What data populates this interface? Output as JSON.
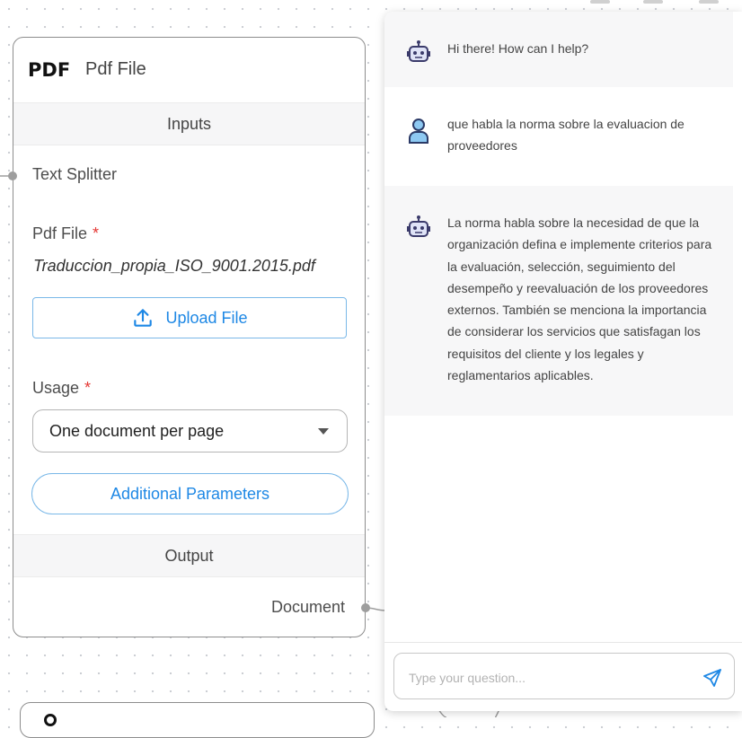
{
  "node": {
    "icon_label": "PDF",
    "title": "Pdf File",
    "inputs_label": "Inputs",
    "text_splitter_label": "Text Splitter",
    "pdf_file_label": "Pdf File",
    "required_mark": "*",
    "pdf_file_value": "Traduccion_propia_ISO_9001.2015.pdf",
    "upload_label": "Upload File",
    "usage_label": "Usage",
    "usage_value": "One document per page",
    "additional_params_label": "Additional Parameters",
    "output_label": "Output",
    "document_label": "Document"
  },
  "chat": {
    "messages": [
      {
        "role": "bot",
        "icon": "robot-icon",
        "text": "Hi there! How can I help?"
      },
      {
        "role": "user",
        "icon": "user-icon",
        "text": "que habla la norma sobre la evaluacion de proveedores"
      },
      {
        "role": "bot",
        "icon": "robot-icon",
        "text": "La norma habla sobre la necesidad de que la organización defina e implemente criterios para la evaluación, selección, seguimiento del desempeño y reevaluación de los proveedores externos. También se menciona la importancia de considerar los servicios que satisfagan los requisitos del cliente y los legales y reglamentarios aplicables."
      }
    ],
    "input_placeholder": "Type your question...",
    "send_icon": "send-icon"
  },
  "colors": {
    "accent": "#1e88e5",
    "required": "#e53935",
    "robot_body": "#3b3b6b",
    "user_icon": "#8ec9f2"
  }
}
